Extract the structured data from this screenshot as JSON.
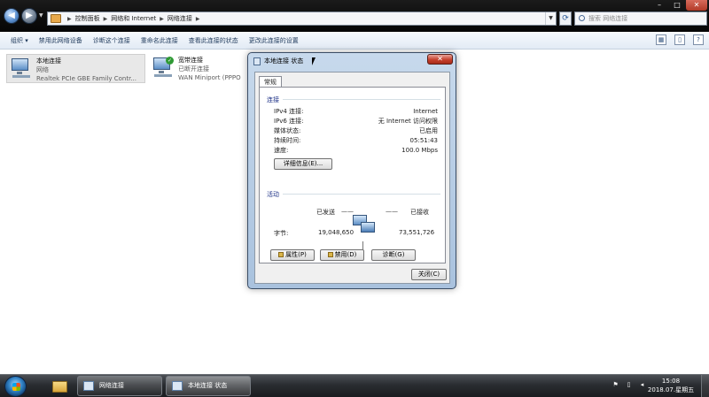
{
  "window": {
    "breadcrumbs": [
      "控制面板",
      "网络和 Internet",
      "网络连接"
    ],
    "search_placeholder": "搜索 网络连接",
    "controls": {
      "minimize": "–",
      "maximize": "□",
      "close": "✕"
    }
  },
  "toolbar": {
    "items": [
      "组织 ▾",
      "禁用此网络设备",
      "诊断这个连接",
      "重命名此连接",
      "查看此连接的状态",
      "更改此连接的设置"
    ]
  },
  "connections": [
    {
      "name": "本地连接",
      "status": "网络",
      "adapter": "Realtek PCIe GBE Family Contr..."
    },
    {
      "name": "宽带连接",
      "status": "已断开连接",
      "adapter": "WAN Miniport (PPPO"
    }
  ],
  "dialog": {
    "title": "本地连接 状态",
    "close_label": "✕",
    "tab": "常规",
    "connection_group": "连接",
    "rows": [
      {
        "label": "IPv4 连接:",
        "value": "Internet"
      },
      {
        "label": "IPv6 连接:",
        "value": "无 Internet 访问权限"
      },
      {
        "label": "媒体状态:",
        "value": "已启用"
      },
      {
        "label": "持续时间:",
        "value": "05:51:43"
      },
      {
        "label": "速度:",
        "value": "100.0 Mbps"
      }
    ],
    "details_button": "详细信息(E)...",
    "activity_group": "活动",
    "sent_label": "已发送",
    "received_label": "已接收",
    "bytes_label": "字节:",
    "bytes_sent": "19,048,650",
    "bytes_received": "73,551,726",
    "properties_button": "属性(P)",
    "disable_button": "禁用(D)",
    "diagnose_button": "诊断(G)",
    "close_button": "关闭(C)"
  },
  "taskbar": {
    "tasks": [
      "网络连接",
      "本地连接 状态"
    ],
    "clock_time": "15:08",
    "clock_date": "2018.07.星期五"
  }
}
